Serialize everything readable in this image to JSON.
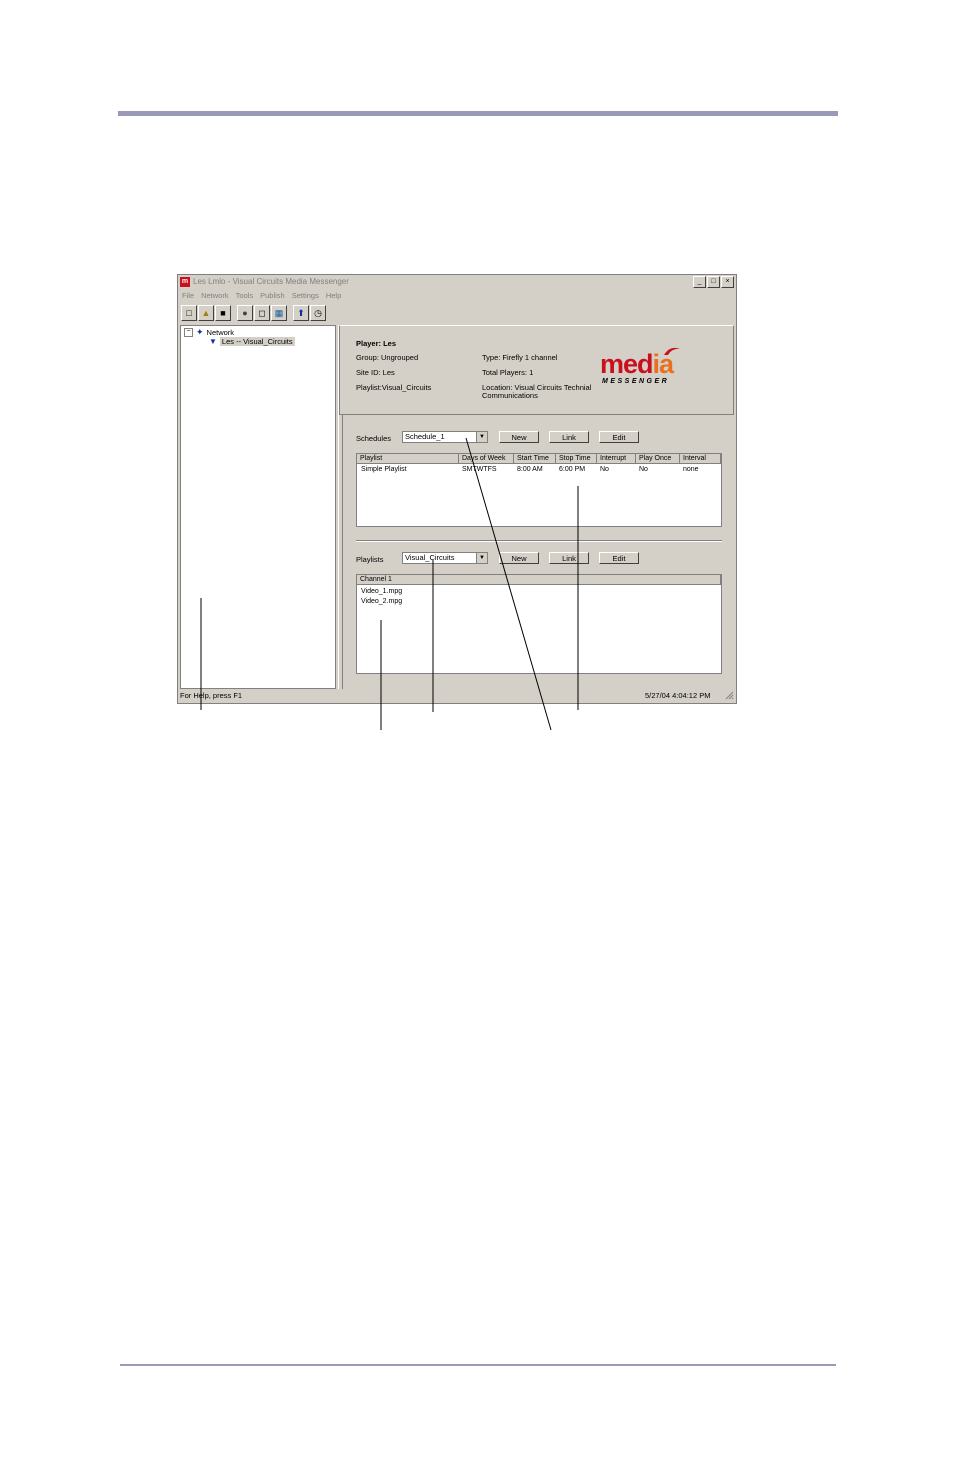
{
  "window": {
    "title": "Les Lmlo - Visual Circuits Media Messenger",
    "app_icon": "m",
    "controls": [
      "_",
      "□",
      "×"
    ]
  },
  "menu": [
    "File",
    "Network",
    "Tools",
    "Publish",
    "Settings",
    "Help"
  ],
  "toolbar_icons": [
    "new-file-icon",
    "open-folder-icon",
    "save-icon",
    "record-icon",
    "blank-window-icon",
    "screen-layout-icon",
    "upload-icon",
    "clock-icon"
  ],
  "tree": {
    "root": "Network",
    "child": "Les -- Visual_Circuits"
  },
  "player_info": {
    "player": "Player: Les",
    "group": "Group: Ungrouped",
    "site_id": "Site ID: Les",
    "playlist": "Playlist:Visual_Circuits",
    "type": "Type: Firefly 1 channel",
    "total_players": "Total Players: 1",
    "location_1": "Location: Visual Circuits Technial",
    "location_2": "Communications"
  },
  "logo": {
    "word_m": "med",
    "word_ia": "ia",
    "sub": "MESSENGER",
    "colors": {
      "red": "#c8101e",
      "orange": "#e8701e"
    }
  },
  "schedules": {
    "label": "Schedules",
    "selected": "Schedule_1",
    "buttons": {
      "new": "New",
      "link": "Link",
      "edit": "Edit"
    },
    "columns": [
      "Playlist",
      "Days of Week",
      "Start Time",
      "Stop Time",
      "Interrupt",
      "Play Once",
      "Interval"
    ],
    "rows": [
      [
        "Simple Playlist",
        "SMTWTFS",
        "8:00 AM",
        "6:00 PM",
        "No",
        "No",
        "none"
      ]
    ]
  },
  "playlists": {
    "label": "Playlists",
    "selected": "Visual_Circuits",
    "buttons": {
      "new": "New",
      "link": "Link",
      "edit": "Edit"
    },
    "column": "Channel 1",
    "items": [
      "Video_1.mpg",
      "Video_2.mpg"
    ]
  },
  "status": {
    "help": "For Help, press F1",
    "datetime": "5/27/04  4:04:12 PM"
  }
}
